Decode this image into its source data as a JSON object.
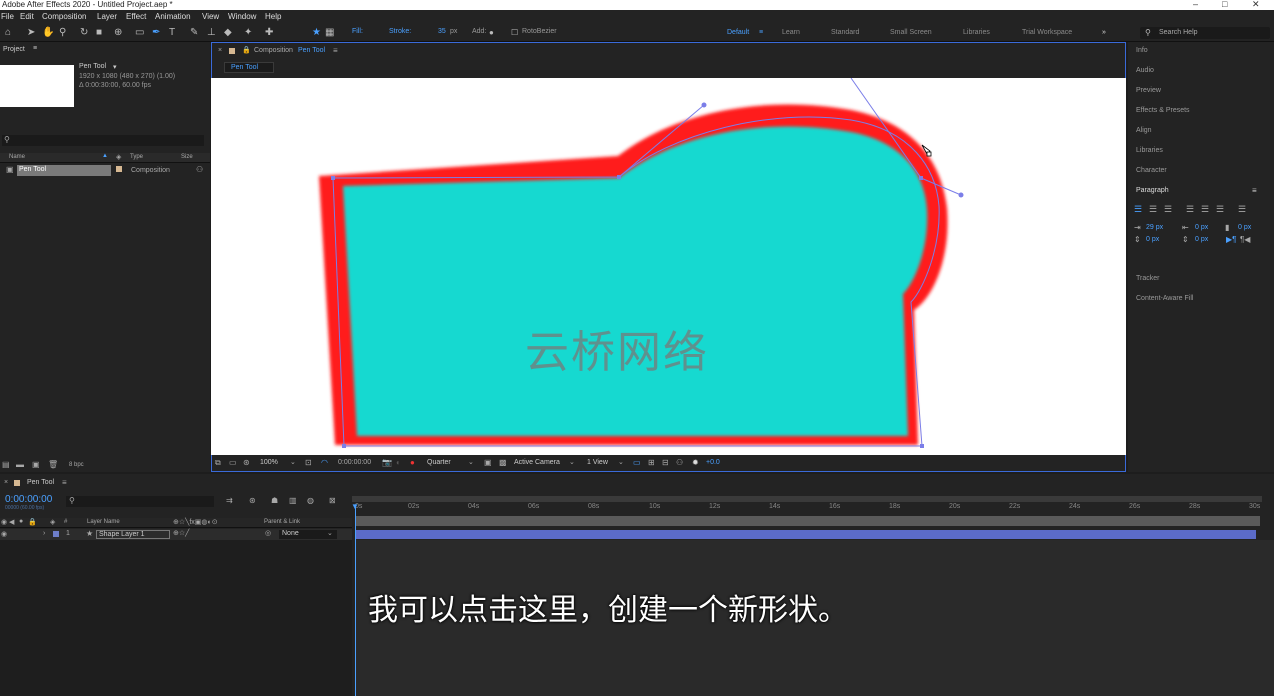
{
  "app": {
    "title": "Adobe After Effects 2020 - Untitled Project.aep *"
  },
  "menu": [
    "File",
    "Edit",
    "Composition",
    "Layer",
    "Effect",
    "Animation",
    "View",
    "Window",
    "Help"
  ],
  "toolbar": {
    "fill_label": "Fill:",
    "stroke_label": "Stroke:",
    "stroke_width": "35",
    "stroke_unit": "px",
    "add_label": "Add:",
    "rotobezier_label": "RotoBezier",
    "fill_color": "#19d9d0",
    "stroke_color": "#ff2020",
    "search_placeholder": "Search Help"
  },
  "workspaces": [
    "Default",
    "Learn",
    "Standard",
    "Small Screen",
    "Libraries",
    "Trial Workspace"
  ],
  "project": {
    "title": "Project",
    "comp_name": "Pen Tool",
    "comp_info_1": "1920 x 1080  (480 x 270) (1.00)",
    "comp_info_2": "Δ 0:00:30:00, 60.00 fps",
    "columns": [
      "Name",
      "Type",
      "Size"
    ],
    "items": [
      {
        "name": "Pen Tool",
        "type": "Composition"
      }
    ],
    "bpc": "8 bpc"
  },
  "composition": {
    "title_prefix": "Composition",
    "name": "Pen Tool",
    "tab": "Pen Tool",
    "zoom": "100%",
    "timecode": "0:00:00:00",
    "resolution": "Quarter",
    "camera": "Active Camera",
    "views": "1 View",
    "exposure": "+0.0",
    "watermark": "云桥网络"
  },
  "right_panels": [
    "Info",
    "Audio",
    "Preview",
    "Effects & Presets",
    "Align",
    "Libraries",
    "Character",
    "Paragraph",
    "Tracker",
    "Content-Aware Fill"
  ],
  "paragraph": {
    "indent_left": "29 px",
    "indent_right": "0 px",
    "space_before": "0 px",
    "first_indent": "0 px",
    "space_after": "0 px",
    "extra": "0 px"
  },
  "timeline": {
    "tab": "Pen Tool",
    "timecode": "0:00:00:00",
    "timecode_sub": "00000 (60.00 fps)",
    "columns": {
      "layer_name": "Layer Name",
      "parent": "Parent & Link"
    },
    "layers": [
      {
        "index": "1",
        "name": "Shape Layer 1",
        "parent": "None"
      }
    ],
    "ruler": [
      "0s",
      "02s",
      "04s",
      "06s",
      "08s",
      "10s",
      "12s",
      "14s",
      "16s",
      "18s",
      "20s",
      "22s",
      "24s",
      "26s",
      "28s",
      "30s"
    ]
  },
  "subtitle": "我可以点击这里，创建一个新形状。"
}
